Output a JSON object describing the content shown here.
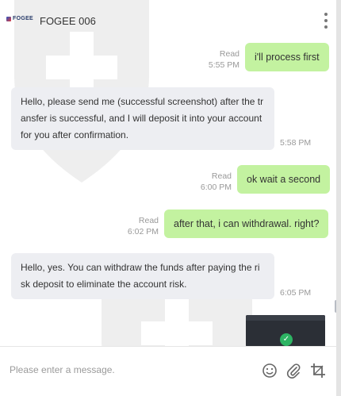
{
  "header": {
    "logo_text": "FOGEE",
    "contact_name": "FOGEE 006",
    "menu_icon": "more-vertical-icon"
  },
  "messages": [
    {
      "direction": "outgoing",
      "status": "Read",
      "time": "5:55 PM",
      "text": "i'll process first"
    },
    {
      "direction": "incoming",
      "time": "5:58 PM",
      "lines": [
        "Hello, please send me (successful screenshot) after the tr",
        "ansfer is successful, and I will deposit it into your account",
        "for you after confirmation."
      ]
    },
    {
      "direction": "outgoing",
      "status": "Read",
      "time": "6:00 PM",
      "text": "ok wait a second"
    },
    {
      "direction": "outgoing",
      "status": "Read",
      "time": "6:02 PM",
      "text": "after that, i can withdrawal. right?"
    },
    {
      "direction": "incoming",
      "time": "6:05 PM",
      "lines": [
        "Hello, yes. You can withdraw the funds after paying the ri",
        "sk deposit to eliminate the account risk."
      ]
    }
  ],
  "composer": {
    "placeholder": "Please enter a message.",
    "value": "",
    "icons": [
      "emoji-icon",
      "attachment-icon",
      "crop-icon"
    ]
  },
  "colors": {
    "outgoing_bubble": "#c3f2a0",
    "incoming_bubble": "#edeef2",
    "meta_text": "#999999"
  }
}
